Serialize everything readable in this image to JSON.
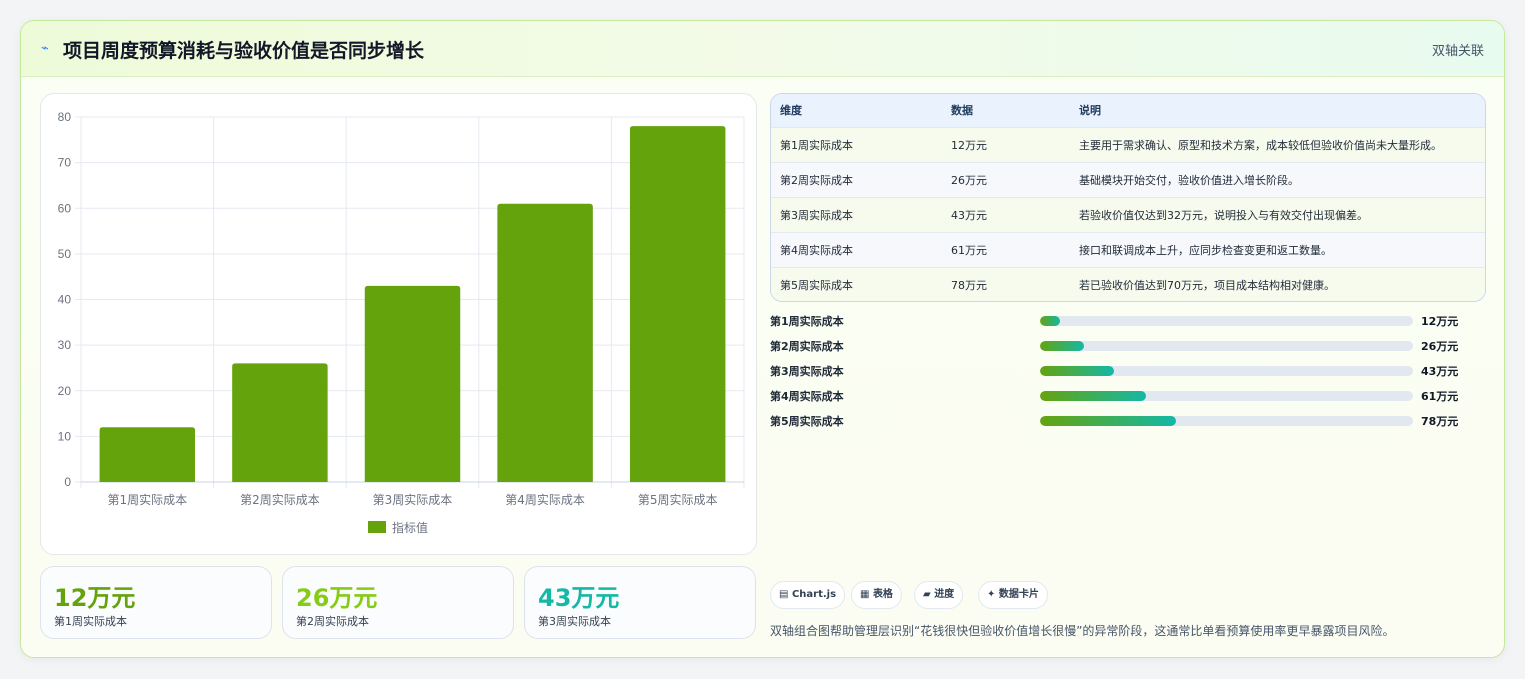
{
  "header": {
    "title": "项目周度预算消耗与验收价值是否同步增长",
    "tag": "双轴关联"
  },
  "chart_data": {
    "type": "bar",
    "categories": [
      "第1周实际成本",
      "第2周实际成本",
      "第3周实际成本",
      "第4周实际成本",
      "第5周实际成本"
    ],
    "series": [
      {
        "name": "指标值",
        "values": [
          12,
          26,
          43,
          61,
          78
        ]
      }
    ],
    "ylim": [
      0,
      80
    ],
    "yticks": [
      0,
      10,
      20,
      30,
      40,
      50,
      60,
      70,
      80
    ],
    "grid": true,
    "legend_position": "bottom",
    "colors": {
      "bar": "#65a30d",
      "grid": "#e5e9f0",
      "tick": "#6b7280"
    }
  },
  "kpis": [
    {
      "value": "12万元",
      "label": "第1周实际成本",
      "color": "#65a30d"
    },
    {
      "value": "26万元",
      "label": "第2周实际成本",
      "color": "#84cc16"
    },
    {
      "value": "43万元",
      "label": "第3周实际成本",
      "color": "#14b8a6"
    }
  ],
  "table": {
    "headers": [
      "维度",
      "数据",
      "说明"
    ],
    "rows": [
      [
        "第1周实际成本",
        "12万元",
        "主要用于需求确认、原型和技术方案，成本较低但验收价值尚未大量形成。"
      ],
      [
        "第2周实际成本",
        "26万元",
        "基础模块开始交付，验收价值进入增长阶段。"
      ],
      [
        "第3周实际成本",
        "43万元",
        "若验收价值仅达到32万元，说明投入与有效交付出现偏差。"
      ],
      [
        "第4周实际成本",
        "61万元",
        "接口和联调成本上升，应同步检查变更和返工数量。"
      ],
      [
        "第5周实际成本",
        "78万元",
        "若已验收价值达到70万元，项目成本结构相对健康。"
      ]
    ]
  },
  "progress": [
    {
      "label": "第1周实际成本",
      "value": "12万元",
      "fraction": 0.054
    },
    {
      "label": "第2周实际成本",
      "value": "26万元",
      "fraction": 0.118
    },
    {
      "label": "第3周实际成本",
      "value": "43万元",
      "fraction": 0.198
    },
    {
      "label": "第4周实际成本",
      "value": "61万元",
      "fraction": 0.285
    },
    {
      "label": "第5周实际成本",
      "value": "78万元",
      "fraction": 0.365
    }
  ],
  "chips": [
    {
      "icon": "▤",
      "label": "Chart.js"
    },
    {
      "icon": "▦",
      "label": "表格"
    },
    {
      "icon": "▰",
      "label": "进度"
    },
    {
      "icon": "✦",
      "label": "数据卡片"
    }
  ],
  "note": "双轴组合图帮助管理层识别“花钱很快但验收价值增长很慢”的异常阶段，这通常比单看预算使用率更早暴露项目风险。"
}
